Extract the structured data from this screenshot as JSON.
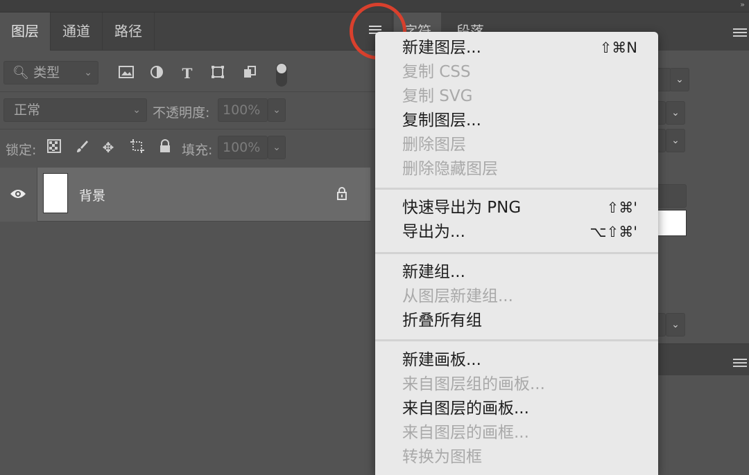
{
  "layers_panel": {
    "tabs": [
      {
        "label": "图层"
      },
      {
        "label": "通道"
      },
      {
        "label": "路径"
      }
    ],
    "filter": {
      "kind_label": "类型"
    },
    "blend_mode": "正常",
    "opacity_label": "不透明度:",
    "opacity_value": "100%",
    "lock_label": "锁定:",
    "fill_label": "填充:",
    "fill_value": "100%",
    "layers": [
      {
        "name": "背景"
      }
    ]
  },
  "char_panel": {
    "tabs": [
      {
        "label": "字符"
      },
      {
        "label": "段落"
      }
    ]
  },
  "context_menu": {
    "groups": [
      [
        {
          "label": "新建图层...",
          "shortcut": "⇧⌘N",
          "enabled": true
        },
        {
          "label": "复制 CSS",
          "shortcut": "",
          "enabled": false
        },
        {
          "label": "复制 SVG",
          "shortcut": "",
          "enabled": false
        },
        {
          "label": "复制图层...",
          "shortcut": "",
          "enabled": true
        },
        {
          "label": "删除图层",
          "shortcut": "",
          "enabled": false
        },
        {
          "label": "删除隐藏图层",
          "shortcut": "",
          "enabled": false
        }
      ],
      [
        {
          "label": "快速导出为 PNG",
          "shortcut": "⇧⌘'",
          "enabled": true
        },
        {
          "label": "导出为...",
          "shortcut": "⌥⇧⌘'",
          "enabled": true
        }
      ],
      [
        {
          "label": "新建组...",
          "shortcut": "",
          "enabled": true
        },
        {
          "label": "从图层新建组...",
          "shortcut": "",
          "enabled": false
        },
        {
          "label": "折叠所有组",
          "shortcut": "",
          "enabled": true
        }
      ],
      [
        {
          "label": "新建画板...",
          "shortcut": "",
          "enabled": true
        },
        {
          "label": "来自图层组的画板...",
          "shortcut": "",
          "enabled": false
        },
        {
          "label": "来自图层的画板...",
          "shortcut": "",
          "enabled": true
        },
        {
          "label": "来自图层的画框...",
          "shortcut": "",
          "enabled": false
        },
        {
          "label": "转换为图框",
          "shortcut": "",
          "enabled": false
        }
      ]
    ]
  },
  "colors": {
    "panel_bg": "#535353",
    "menu_bg": "#e9e9e9",
    "highlight": "#d9402d"
  }
}
